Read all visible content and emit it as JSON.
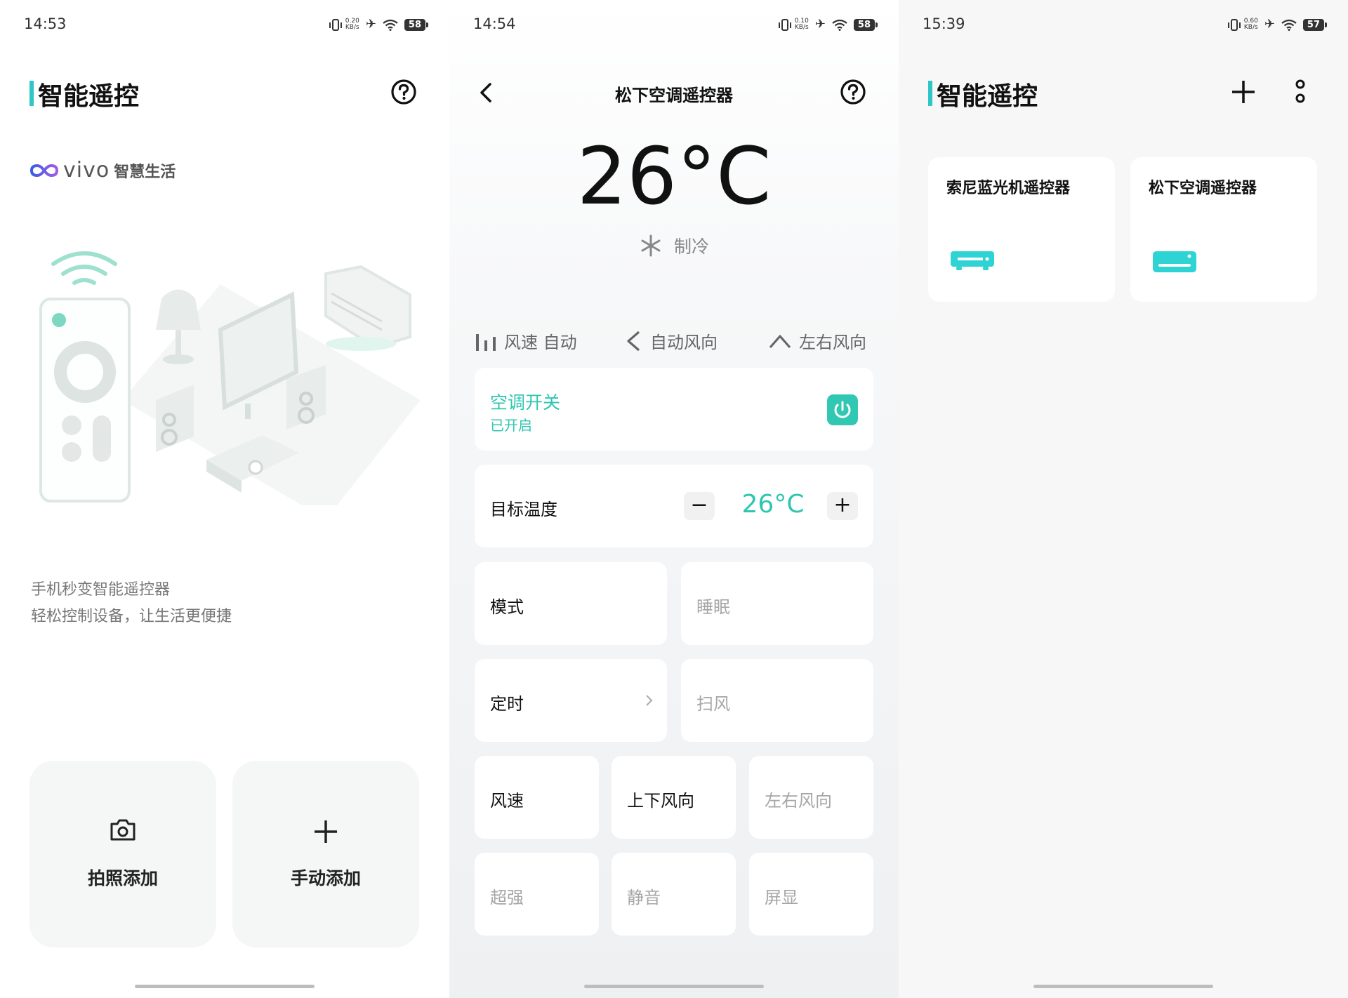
{
  "panels": [
    {
      "status": {
        "time": "14:53",
        "speed_top": "0.20",
        "speed_unit": "KB/s",
        "battery": "58"
      },
      "header": {
        "title": "智能遥控"
      },
      "brand": {
        "vivo": "vivo",
        "sub": "智慧生活"
      },
      "tagline": [
        "手机秒变智能遥控器",
        "轻松控制设备，让生活更便捷"
      ],
      "actions": [
        {
          "label": "拍照添加",
          "icon": "camera-icon"
        },
        {
          "label": "手动添加",
          "icon": "plus-icon"
        }
      ]
    },
    {
      "status": {
        "time": "14:54",
        "speed_top": "0.10",
        "speed_unit": "KB/s",
        "battery": "58"
      },
      "header": {
        "title": "松下空调遥控器"
      },
      "temp": {
        "value": "26°C",
        "mode_label": "制冷"
      },
      "chips": [
        {
          "label": "风速 自动"
        },
        {
          "label": "自动风向"
        },
        {
          "label": "左右风向"
        }
      ],
      "power": {
        "title": "空调开关",
        "status": "已开启"
      },
      "target": {
        "label": "目标温度",
        "value": "26°C",
        "minus": "−",
        "plus": "+"
      },
      "grid": {
        "mode": "模式",
        "sleep": "睡眠",
        "timer": "定时",
        "sweep": "扫风",
        "speed": "风速",
        "updown": "上下风向",
        "leftright": "左右风向",
        "turbo": "超强",
        "mute": "静音",
        "display": "屏显"
      },
      "accent": "#2ec6b0"
    },
    {
      "status": {
        "time": "15:39",
        "speed_top": "0.60",
        "speed_unit": "KB/s",
        "battery": "57"
      },
      "header": {
        "title": "智能遥控"
      },
      "devices": [
        {
          "name": "索尼蓝光机遥控器",
          "icon": "bluray-player-icon"
        },
        {
          "name": "松下空调遥控器",
          "icon": "air-conditioner-icon"
        }
      ],
      "accent": "#2ed3d3"
    }
  ]
}
